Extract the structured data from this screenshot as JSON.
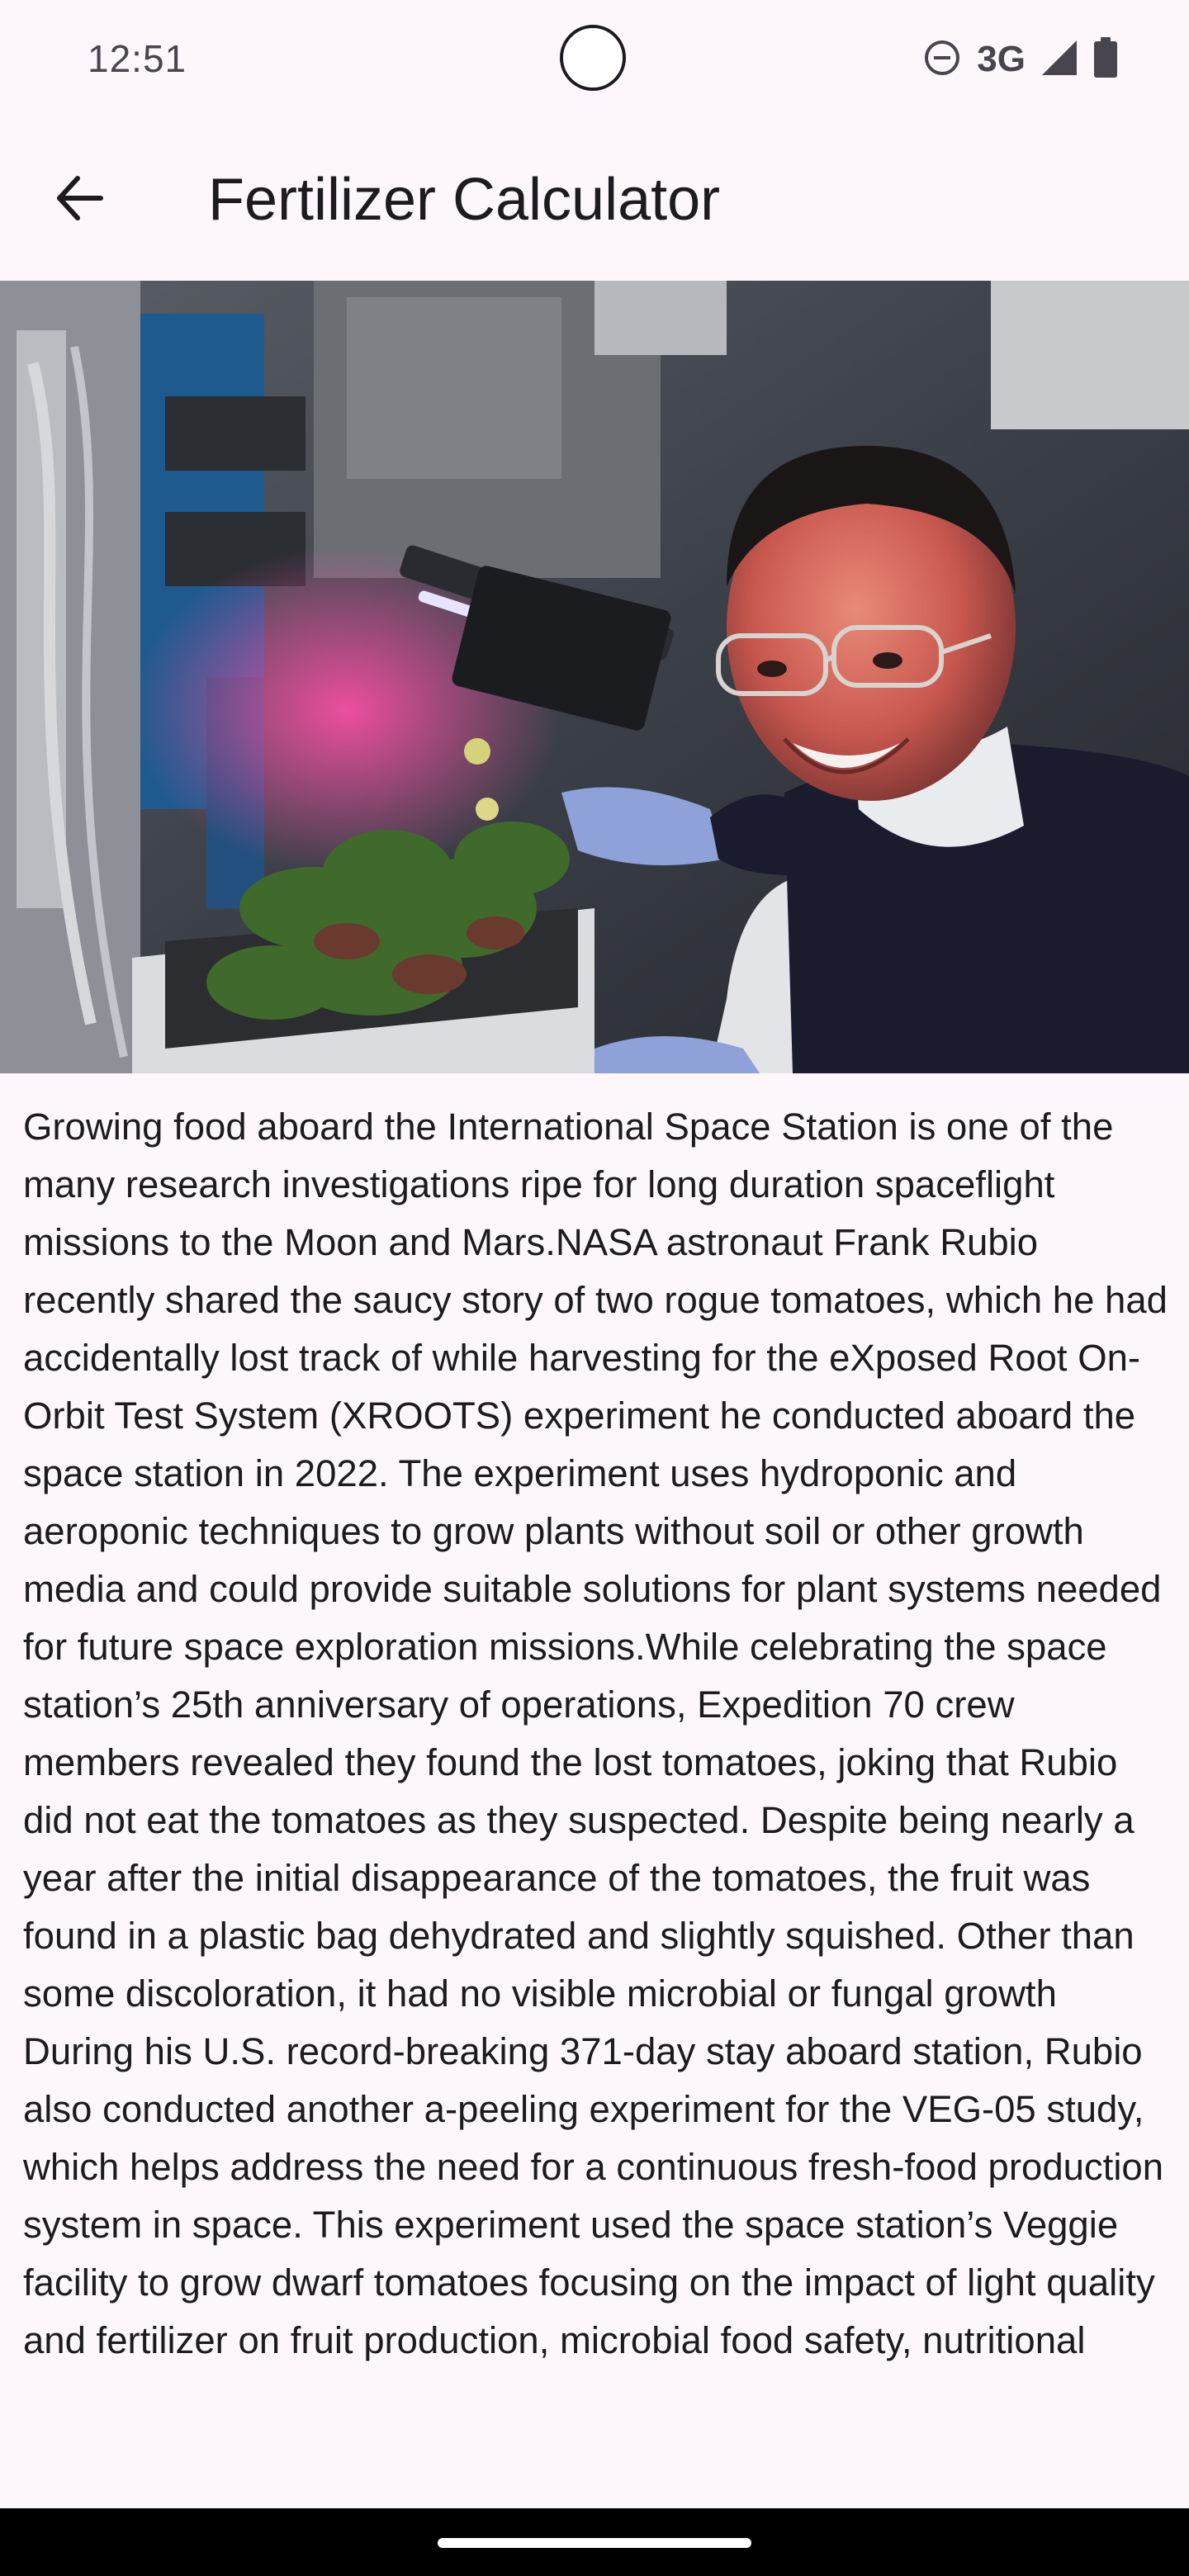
{
  "status_bar": {
    "time": "12:51",
    "network_label": "3G",
    "icons": [
      "do-not-disturb-icon",
      "signal-icon",
      "battery-icon"
    ]
  },
  "app_bar": {
    "title": "Fertilizer Calculator",
    "back_icon": "arrow-back-icon"
  },
  "hero_image": {
    "description_icon": "astronaut-tomato-photo"
  },
  "article": {
    "text": "Growing food aboard the International Space Station is one of the many research investigations ripe for long duration spaceflight missions to the Moon and Mars.NASA astronaut Frank Rubio recently shared the saucy story of two rogue tomatoes, which he had accidentally lost track of while harvesting for the eXposed Root On-Orbit Test System (XROOTS) experiment he conducted aboard the space station in 2022. The experiment uses hydroponic and aeroponic techniques to grow plants without soil or other growth media and could provide suitable solutions for plant systems needed for future space exploration missions.While celebrating the space station’s 25th anniversary of operations, Expedition 70 crew members revealed they found the lost tomatoes, joking that Rubio did not eat the tomatoes as they suspected. Despite being nearly a year after the initial disappearance of the tomatoes, the fruit was found in a plastic bag dehydrated and slightly squished. Other than some discoloration, it had no visible microbial or fungal growth During his U.S. record-breaking 371-day stay aboard station, Rubio also conducted another a-peeling experiment for the VEG-05 study, which helps address the need for a continuous fresh-food production system in space. This experiment used the space station’s Veggie facility to grow dwarf tomatoes focusing on the impact of light quality and fertilizer on fruit production, microbial food safety, nutritional"
  },
  "colors": {
    "background": "#fdf7fc",
    "text": "#1d1b20",
    "status_icons": "#49454f",
    "nav_bar": "#000000"
  }
}
